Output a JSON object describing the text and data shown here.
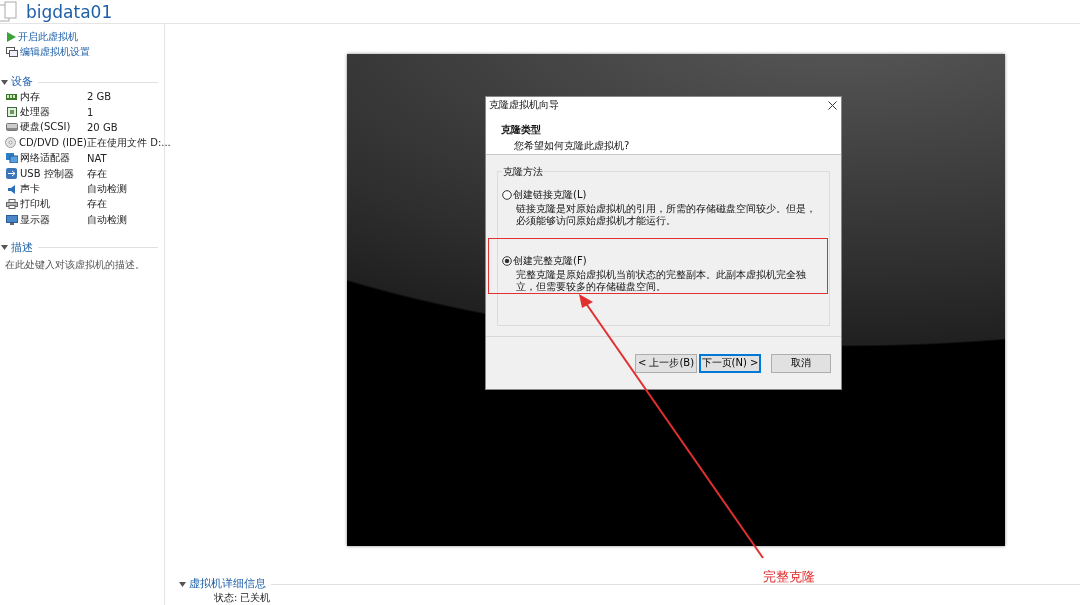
{
  "header": {
    "title": "bigdata01"
  },
  "actions": [
    {
      "label": "开启此虚拟机",
      "kind": "power"
    },
    {
      "label": "编辑虚拟机设置",
      "kind": "edit"
    }
  ],
  "devices": {
    "title": "设备",
    "items": [
      {
        "name": "内存",
        "value": "2 GB",
        "kind": "memory"
      },
      {
        "name": "处理器",
        "value": "1",
        "kind": "cpu"
      },
      {
        "name": "硬盘(SCSI)",
        "value": "20 GB",
        "kind": "disk"
      },
      {
        "name": "CD/DVD (IDE)",
        "value": "正在使用文件 D:...",
        "kind": "cd"
      },
      {
        "name": "网络适配器",
        "value": "NAT",
        "kind": "network"
      },
      {
        "name": "USB 控制器",
        "value": "存在",
        "kind": "usb"
      },
      {
        "name": "声卡",
        "value": "自动检测",
        "kind": "sound"
      },
      {
        "name": "打印机",
        "value": "存在",
        "kind": "printer"
      },
      {
        "name": "显示器",
        "value": "自动检测",
        "kind": "display"
      }
    ]
  },
  "description": {
    "title": "描述",
    "placeholder": "在此处键入对该虚拟机的描述。"
  },
  "details": {
    "title": "虚拟机详细信息",
    "rows": [
      {
        "label": "状态:",
        "value": "已关机"
      }
    ]
  },
  "dialog": {
    "title": "克隆虚拟机向导",
    "heading": "克隆类型",
    "subheading": "您希望如何克隆此虚拟机?",
    "group_title": "克隆方法",
    "options": [
      {
        "label": "创建链接克隆(L)",
        "description": "链接克隆是对原始虚拟机的引用，所需的存储磁盘空间较少。但是，必须能够访问原始虚拟机才能运行。",
        "selected": false
      },
      {
        "label": "创建完整克隆(F)",
        "description": "完整克隆是原始虚拟机当前状态的完整副本。此副本虚拟机完全独立，但需要较多的存储磁盘空间。",
        "selected": true
      }
    ],
    "buttons": [
      {
        "label": "< 上一步(B)",
        "default": false
      },
      {
        "label": "下一页(N) >",
        "default": true
      },
      {
        "label": "取消",
        "default": false
      }
    ]
  },
  "annotation": {
    "label": "完整克隆"
  }
}
